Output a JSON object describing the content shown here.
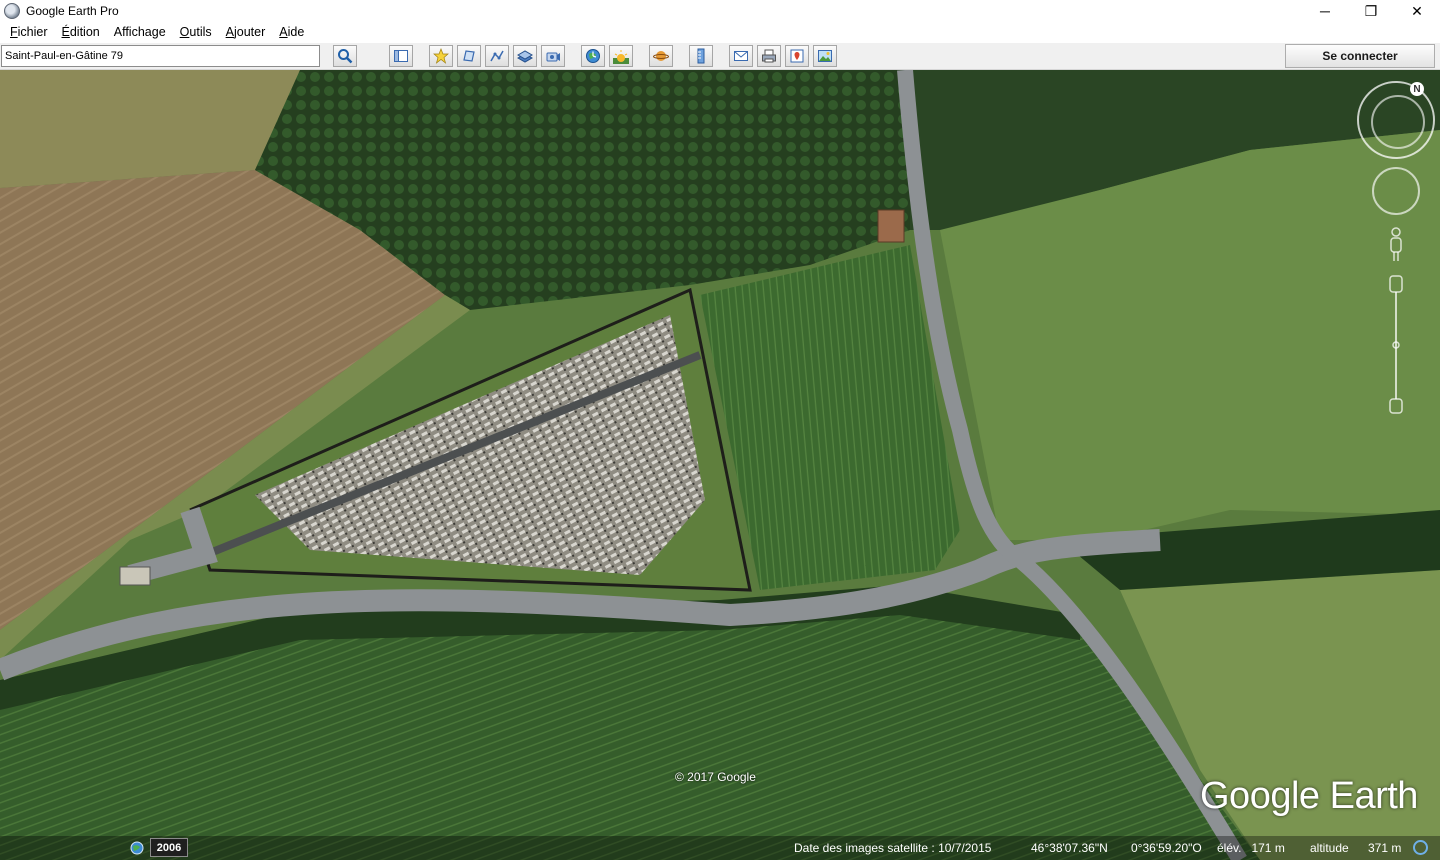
{
  "window": {
    "title": "Google Earth Pro",
    "minimize_glyph": "─",
    "restore_glyph": "❐",
    "close_glyph": "✕"
  },
  "menu": {
    "items": [
      {
        "first": "F",
        "rest": "ichier"
      },
      {
        "first": "É",
        "rest": "dition"
      },
      {
        "first": "",
        "rest": "Affichage"
      },
      {
        "first": "O",
        "rest": "utils"
      },
      {
        "first": "A",
        "rest": "jouter"
      },
      {
        "first": "A",
        "rest": "ide"
      }
    ]
  },
  "toolbar": {
    "search_value": "Saint-Paul-en-Gâtine 79",
    "connect_label": "Se connecter",
    "icons": [
      "search-icon",
      "sidebar-icon",
      "placemark-icon",
      "polygon-icon",
      "path-icon",
      "image-overlay-icon",
      "record-tour-icon",
      "historical-imagery-icon",
      "sunlight-icon",
      "planets-icon",
      "ruler-icon",
      "email-icon",
      "print-icon",
      "save-image-icon",
      "view-in-maps-icon"
    ]
  },
  "map": {
    "copyright": "© 2017 Google",
    "logo": "Google Earth",
    "north_label": "N"
  },
  "status": {
    "year": "2006",
    "imagery_date": "Date des images satellite : 10/7/2015",
    "latitude": "46°38'07.36\"N",
    "longitude": "0°36'59.20\"O",
    "elevation": "élév.   171 m",
    "altitude_label": "altitude",
    "altitude_value": "371 m"
  },
  "colors": {
    "toolbar_bg": "#f0f0f0",
    "forest": "#2c4a26",
    "field_brown": "#8f7a5a",
    "crop_green": "#365f2c",
    "pasture": "#5b7a3f",
    "road": "#8d9194",
    "accent_blue": "#6fb0e8"
  }
}
